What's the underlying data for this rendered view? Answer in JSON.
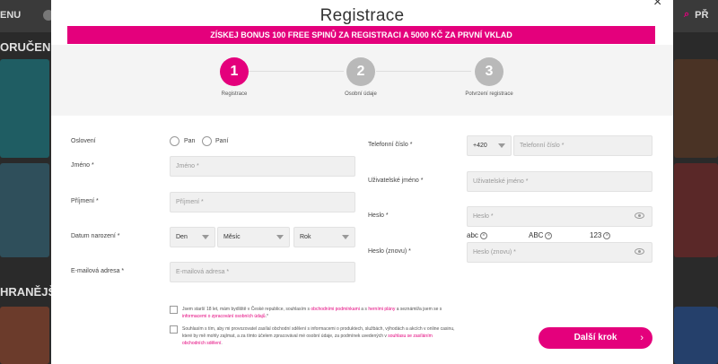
{
  "background": {
    "menu": "ENU",
    "profile": "PŘ",
    "heading_1": "ORUČENĚ",
    "heading_2": "HRANĚJŠ"
  },
  "modal": {
    "close": "×",
    "title": "Registrace",
    "banner": "ZÍSKEJ BONUS 100 FREE SPINŮ ZA REGISTRACI A 5000 KČ ZA PRVNÍ VKLAD",
    "steps": [
      {
        "num": "1",
        "label": "Registrace"
      },
      {
        "num": "2",
        "label": "Osobní údaje"
      },
      {
        "num": "3",
        "label": "Potvrzení registrace"
      }
    ],
    "left": {
      "salutation_label": "Oslovení",
      "mr": "Pan",
      "ms": "Paní",
      "first_name_label": "Jméno *",
      "first_name_placeholder": "Jméno *",
      "last_name_label": "Příjmení *",
      "last_name_placeholder": "Příjmení *",
      "dob_label": "Datum narození *",
      "day": "Den",
      "month": "Měsíc",
      "year": "Rok",
      "email_label": "E-mailová adresa *",
      "email_placeholder": "E-mailová adresa *"
    },
    "right": {
      "phone_label": "Telefonní číslo *",
      "phone_prefix": "+420",
      "phone_placeholder": "Telefonní číslo *",
      "username_label": "Uživatelské jméno *",
      "username_placeholder": "Uživatelské jméno *",
      "password_label": "Heslo *",
      "password_placeholder": "Heslo *",
      "hint_abc": "abc",
      "hint_ABC": "ABC",
      "hint_123": "123",
      "password2_label": "Heslo (znovu) *",
      "password2_placeholder": "Heslo (znovu) *"
    },
    "consent1": {
      "part1": "Jsem starší 18 let, mám bydliště v České republice, souhlasím s ",
      "link1": "obchodními podmínkami",
      "part2": " a s ",
      "link2": "herními plány",
      "part3": " a seznámil/a jsem se s ",
      "link3": "informacemi o zpracování osobních údajů",
      "part4": ".*"
    },
    "consent2": {
      "part1": "Souhlasím s tím, aby mi provozovatel zasílal obchodní sdělení s informacemi o produktech, službách, výhodách a akcích v online casinu, které by mě mohly zajímat, a za tímto účelem zpracovával mé osobní údaje, za podmínek uvedených v ",
      "link1": "souhlasu se zasíláním obchodních sdělení",
      "part2": "."
    },
    "next_button": "Další krok",
    "next_chevron": "›"
  },
  "colors": {
    "accent": "#e4007c",
    "step_inactive": "#b9b9b9"
  }
}
